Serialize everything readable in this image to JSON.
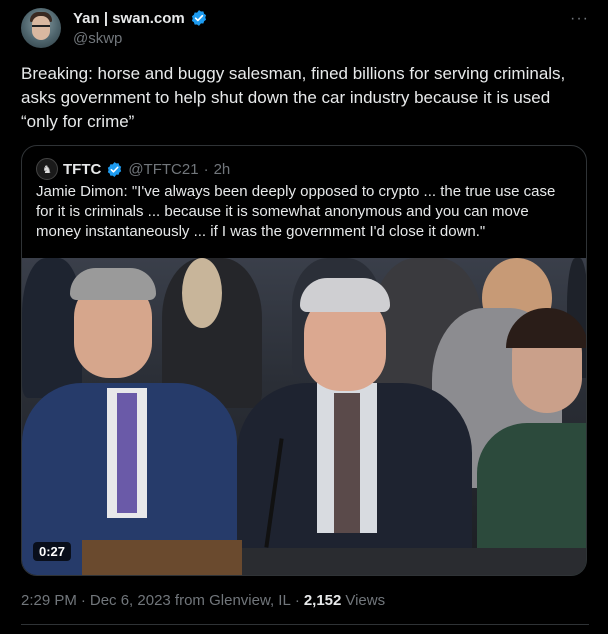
{
  "author": {
    "display_name": "Yan | swan.com",
    "handle": "@skwp",
    "verified_icon": "verified-badge-icon"
  },
  "tweet": {
    "text": "Breaking: horse and buggy salesman, fined billions for serving criminals, asks government to help shut down the car industry because it is used “only for crime”"
  },
  "quoted": {
    "display_name": "TFTC",
    "handle": "@TFTC21",
    "separator": "·",
    "time_ago": "2h",
    "text": "Jamie Dimon: \"I've always been deeply opposed to crypto ... the true use case for it is criminals ... because it is somewhat anonymous and you can move money instantaneously ... if I was the government I'd close it down.\"",
    "video": {
      "duration": "0:27"
    }
  },
  "meta": {
    "time": "2:29 PM",
    "dot": "·",
    "date": "Dec 6, 2023 from Glenview, IL",
    "dot2": "·",
    "views_count": "2,152",
    "views_label": "Views"
  },
  "colors": {
    "background": "#000000",
    "text_primary": "#e7e9ea",
    "text_secondary": "#71767b",
    "verified_blue": "#1d9bf0",
    "border": "#2f3336"
  }
}
